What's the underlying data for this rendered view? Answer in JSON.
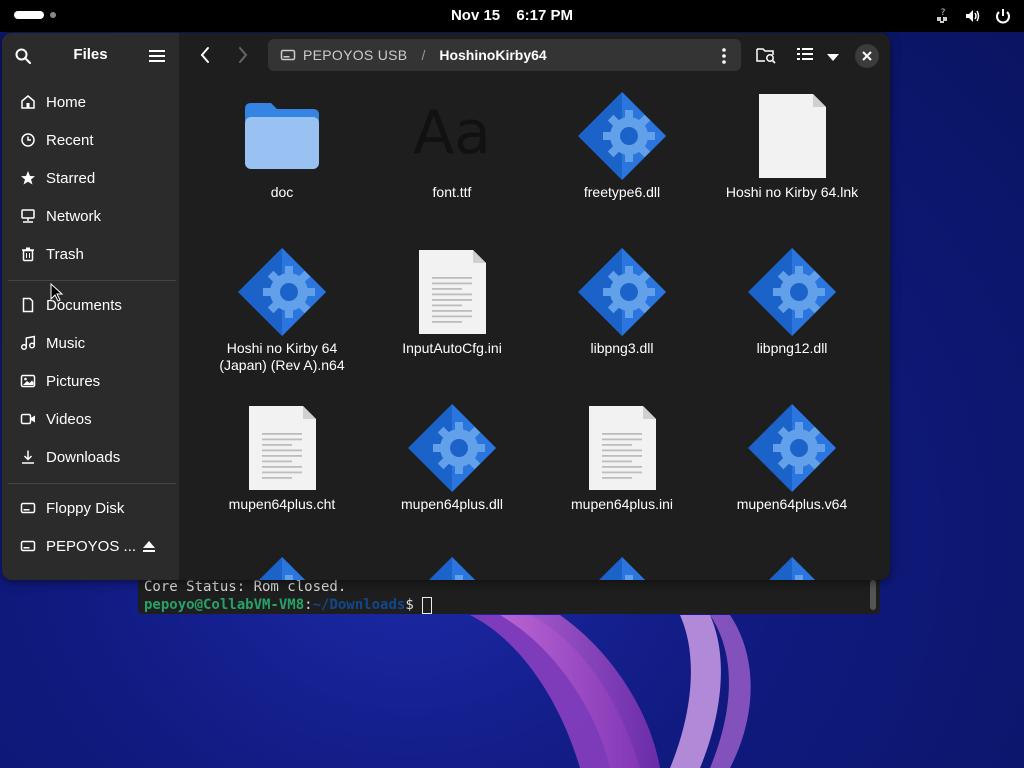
{
  "topbar": {
    "date": "Nov 15",
    "time": "6:17 PM",
    "icons": [
      "network-help-icon",
      "volume-icon",
      "power-icon"
    ]
  },
  "files": {
    "sidebar": {
      "title": "Files",
      "places": [
        {
          "label": "Home",
          "icon": "home-icon"
        },
        {
          "label": "Recent",
          "icon": "clock-icon"
        },
        {
          "label": "Starred",
          "icon": "star-icon"
        },
        {
          "label": "Network",
          "icon": "network-icon"
        },
        {
          "label": "Trash",
          "icon": "trash-icon"
        }
      ],
      "bookmarks": [
        {
          "label": "Documents",
          "icon": "document-icon"
        },
        {
          "label": "Music",
          "icon": "music-icon"
        },
        {
          "label": "Pictures",
          "icon": "pictures-icon"
        },
        {
          "label": "Videos",
          "icon": "video-icon"
        },
        {
          "label": "Downloads",
          "icon": "download-icon"
        }
      ],
      "devices": [
        {
          "label": "Floppy Disk",
          "icon": "drive-icon"
        },
        {
          "label": "PEPOYOS ...",
          "icon": "drive-icon"
        }
      ]
    },
    "path": {
      "segment1": "PEPOYOS USB",
      "separator": "/",
      "segment2": "HoshinoKirby64"
    },
    "items": [
      {
        "name": "doc",
        "icon": "folder"
      },
      {
        "name": "font.ttf",
        "icon": "font",
        "glyph": "Aa"
      },
      {
        "name": "freetype6.dll",
        "icon": "gear"
      },
      {
        "name": "Hoshi no Kirby 64.lnk",
        "icon": "blank"
      },
      {
        "name": "Hoshi no Kirby 64 (Japan) (Rev A).n64",
        "icon": "gear"
      },
      {
        "name": "InputAutoCfg.ini",
        "icon": "text"
      },
      {
        "name": "libpng3.dll",
        "icon": "gear"
      },
      {
        "name": "libpng12.dll",
        "icon": "gear"
      },
      {
        "name": "mupen64plus.cht",
        "icon": "text"
      },
      {
        "name": "mupen64plus.dll",
        "icon": "gear"
      },
      {
        "name": "mupen64plus.ini",
        "icon": "text"
      },
      {
        "name": "mupen64plus.v64",
        "icon": "gear"
      }
    ]
  },
  "terminal": {
    "line1": "Core Status: Rom closed.",
    "user": "pepoyo@CollabVM-VM8",
    "colon": ":",
    "path": "~/Downloads",
    "prompt": "$ "
  },
  "colors": {
    "accent": "#3584e4",
    "folder": "#99c1f1",
    "gear_dark": "#1c63c9",
    "gear_light": "#4a9af0"
  }
}
